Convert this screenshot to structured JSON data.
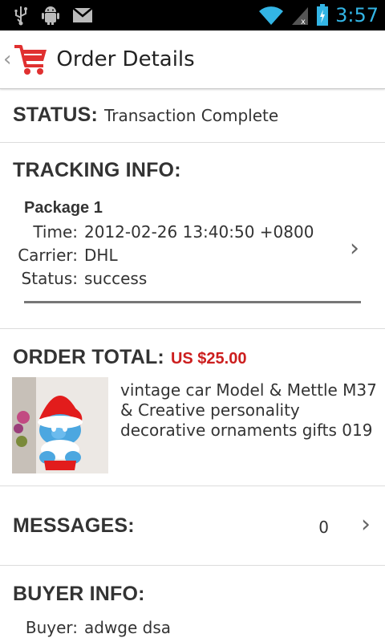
{
  "status_bar": {
    "left_icons": [
      "usb-icon",
      "android-debug-icon",
      "gmail-icon"
    ],
    "right_icons": [
      "wifi-icon",
      "signal-icon",
      "battery-icon"
    ],
    "time": "3:57"
  },
  "action_bar": {
    "title": "Order Details",
    "icon": "shopping-cart-icon"
  },
  "status": {
    "label": "STATUS:",
    "value": "Transaction Complete"
  },
  "tracking": {
    "heading": "TRACKING INFO:",
    "package_title": "Package 1",
    "rows": [
      {
        "label": "Time:",
        "value": "2012-02-26 13:40:50 +0800"
      },
      {
        "label": "Carrier:",
        "value": "DHL"
      },
      {
        "label": "Status:",
        "value": "success"
      }
    ]
  },
  "order_total": {
    "heading": "ORDER TOTAL:",
    "amount": "US $25.00",
    "product_title": "vintage car Model & Mettle M37 & Creative personality decorative ornaments gifts 019",
    "product_image": "smurf-plush-toy-image"
  },
  "messages": {
    "heading": "MESSAGES:",
    "count": "0"
  },
  "buyer": {
    "heading": "BUYER INFO:",
    "label": "Buyer:",
    "value": "adwge dsa"
  },
  "colors": {
    "accent_red": "#cc1e1e",
    "status_time": "#33b5e5"
  }
}
